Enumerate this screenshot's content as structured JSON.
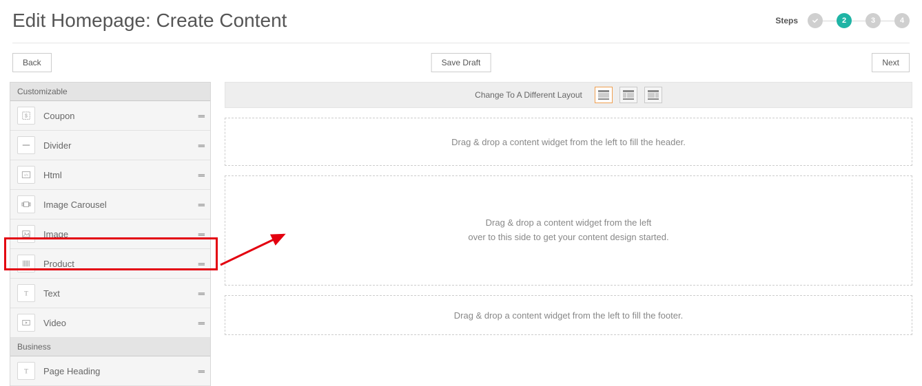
{
  "header": {
    "title": "Edit Homepage: Create Content",
    "steps_label": "Steps",
    "steps": [
      {
        "label": "✓",
        "state": "done"
      },
      {
        "label": "2",
        "state": "active"
      },
      {
        "label": "3",
        "state": ""
      },
      {
        "label": "4",
        "state": ""
      }
    ]
  },
  "toolbar": {
    "back": "Back",
    "save_draft": "Save Draft",
    "next": "Next"
  },
  "sidebar": {
    "section1": "Customizable",
    "items": [
      {
        "label": "Coupon",
        "icon": "coupon"
      },
      {
        "label": "Divider",
        "icon": "divider"
      },
      {
        "label": "Html",
        "icon": "html"
      },
      {
        "label": "Image Carousel",
        "icon": "carousel"
      },
      {
        "label": "Image",
        "icon": "image"
      },
      {
        "label": "Product",
        "icon": "product"
      },
      {
        "label": "Text",
        "icon": "text"
      },
      {
        "label": "Video",
        "icon": "video"
      }
    ],
    "section2": "Business",
    "business_items": [
      {
        "label": "Page Heading",
        "icon": "text"
      }
    ]
  },
  "content": {
    "layout_label": "Change To A Different Layout",
    "drop_header": "Drag & drop a content widget from the left to fill the header.",
    "drop_main_l1": "Drag & drop a content widget from the left",
    "drop_main_l2": "over to this side to get your content design started.",
    "drop_footer": "Drag & drop a content widget from the left to fill the footer."
  }
}
